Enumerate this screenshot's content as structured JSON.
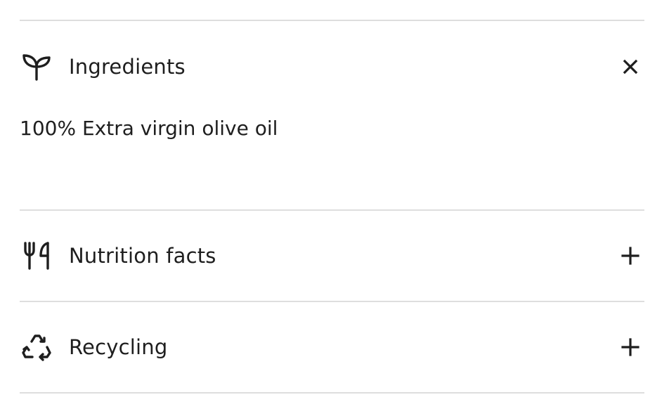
{
  "accordion": {
    "sections": [
      {
        "title": "Ingredients",
        "icon": "leaf-icon",
        "expanded": true,
        "toggle_icon": "close-icon",
        "content": "100% Extra virgin olive oil"
      },
      {
        "title": "Nutrition facts",
        "icon": "utensils-icon",
        "expanded": false,
        "toggle_icon": "plus-icon"
      },
      {
        "title": "Recycling",
        "icon": "recycle-icon",
        "expanded": false,
        "toggle_icon": "plus-icon"
      }
    ]
  }
}
